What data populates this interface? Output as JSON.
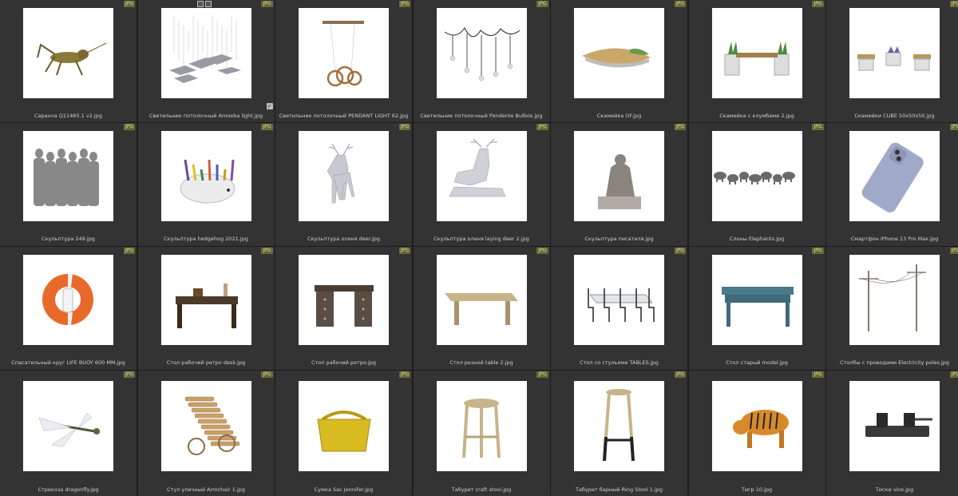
{
  "badge": "JPG",
  "items": [
    {
      "caption": "Саранча Q11465.1 v2.jpg",
      "icon": "grasshopper"
    },
    {
      "caption": "Светильник потолочный Amoeba light.jpg",
      "icon": "amoeba-light"
    },
    {
      "caption": "Светильник потолочный PENDANT LIGHT 62.jpg",
      "icon": "pendant-rings"
    },
    {
      "caption": "Светильник потолочный Pendente Bulbos.jpg",
      "icon": "bulb-pendants"
    },
    {
      "caption": "Скамейка OF.jpg",
      "icon": "bench-curved"
    },
    {
      "caption": "Скамейка с клумбами 2.jpg",
      "icon": "bench-planters"
    },
    {
      "caption": "Скамейки CUBE 50x50x50.jpg",
      "icon": "bench-cube"
    },
    {
      "caption": "Скульптура 249.jpg",
      "icon": "sculpture-group"
    },
    {
      "caption": "Скульптура hedgehog 2021.jpg",
      "icon": "hedgehog"
    },
    {
      "caption": "Скульптура оленя deer.jpg",
      "icon": "deer-standing"
    },
    {
      "caption": "Скульптура оленя laying deer 2.jpg",
      "icon": "deer-laying"
    },
    {
      "caption": "Скульптура писателя.jpg",
      "icon": "writer-statue"
    },
    {
      "caption": "Слоны Elephants.jpg",
      "icon": "elephants"
    },
    {
      "caption": "Смартфон iPhone 13 Pro Max.jpg",
      "icon": "smartphone"
    },
    {
      "caption": "Спасательный круг LIFE BUOY 600 MM.jpg",
      "icon": "life-buoy"
    },
    {
      "caption": "Стол рабочий ретро desk.jpg",
      "icon": "retro-desk"
    },
    {
      "caption": "Стол рабочий ретро.jpg",
      "icon": "retro-desk-2"
    },
    {
      "caption": "Стол резной table 2.jpg",
      "icon": "carved-table"
    },
    {
      "caption": "Стол со стульями TABLES.jpg",
      "icon": "table-chairs"
    },
    {
      "caption": "Стол старый model.jpg",
      "icon": "old-table"
    },
    {
      "caption": "Столбы с проводами Electricity poles.jpg",
      "icon": "electricity-poles"
    },
    {
      "caption": "Стрекоза dragonfly.jpg",
      "icon": "dragonfly"
    },
    {
      "caption": "Стул уличный Armchair 1.jpg",
      "icon": "armchair"
    },
    {
      "caption": "Сумка Sac Jennifer.jpg",
      "icon": "handbag"
    },
    {
      "caption": "Табурет craft stool.jpg",
      "icon": "craft-stool"
    },
    {
      "caption": "Табурет барный Ring Stool 1.jpg",
      "icon": "bar-stool"
    },
    {
      "caption": "Тигр 10.jpg",
      "icon": "tiger"
    },
    {
      "caption": "Тиски vice.jpg",
      "icon": "vice"
    }
  ]
}
